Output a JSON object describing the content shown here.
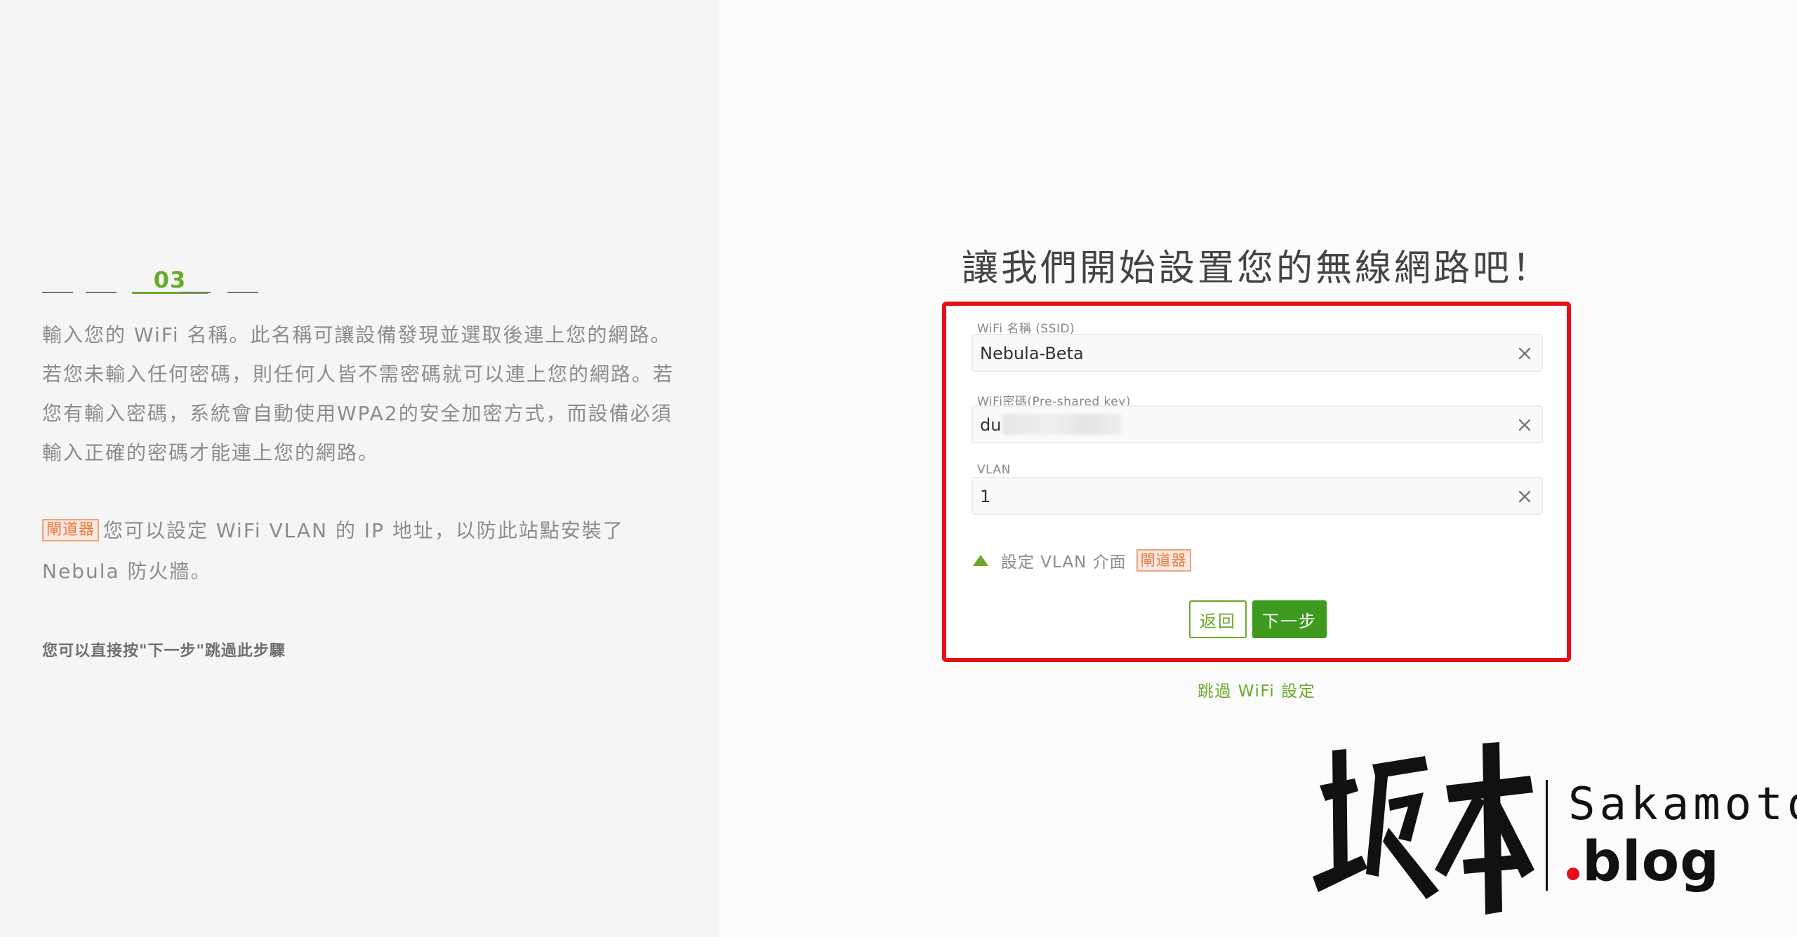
{
  "left": {
    "step_current": "03",
    "description": "輸入您的 WiFi 名稱。此名稱可讓設備發現並選取後連上您的網路。若您未輸入任何密碼，則任何人皆不需密碼就可以連上您的網路。若您有輸入密碼，系統會自動使用WPA2的安全加密方式，而設備必須輸入正確的密碼才能連上您的網路。",
    "gateway_badge": "閘道器",
    "gateway_text": "您可以設定 WiFi VLAN 的 IP 地址，以防此站點安裝了 Nebula 防火牆。",
    "hint": "您可以直接按\"下一步\"跳過此步驟"
  },
  "form": {
    "title": "讓我們開始設置您的無線網路吧！",
    "ssid_label": "WiFi 名稱 (SSID)",
    "ssid_value": "Nebula-Beta",
    "psk_label": "WiFi密碼(Pre-shared key)",
    "psk_value": "du",
    "vlan_label": "VLAN",
    "vlan_value": "1",
    "vlan_toggle_text": "設定 VLAN 介面",
    "vlan_badge": "閘道器",
    "back_label": "返回",
    "next_label": "下一步",
    "skip_label": "跳過 WiFi 設定"
  },
  "watermark": {
    "kanji": "坂本",
    "name": "Sakamoto",
    "domain": "blog"
  },
  "colors": {
    "accent": "#6aaa2a",
    "button_green": "#3d9a1e",
    "highlight_border": "#e3101a",
    "gateway_badge": "#e87c44"
  },
  "icons": {
    "clear": "close-icon",
    "toggle": "triangle-up-icon"
  }
}
